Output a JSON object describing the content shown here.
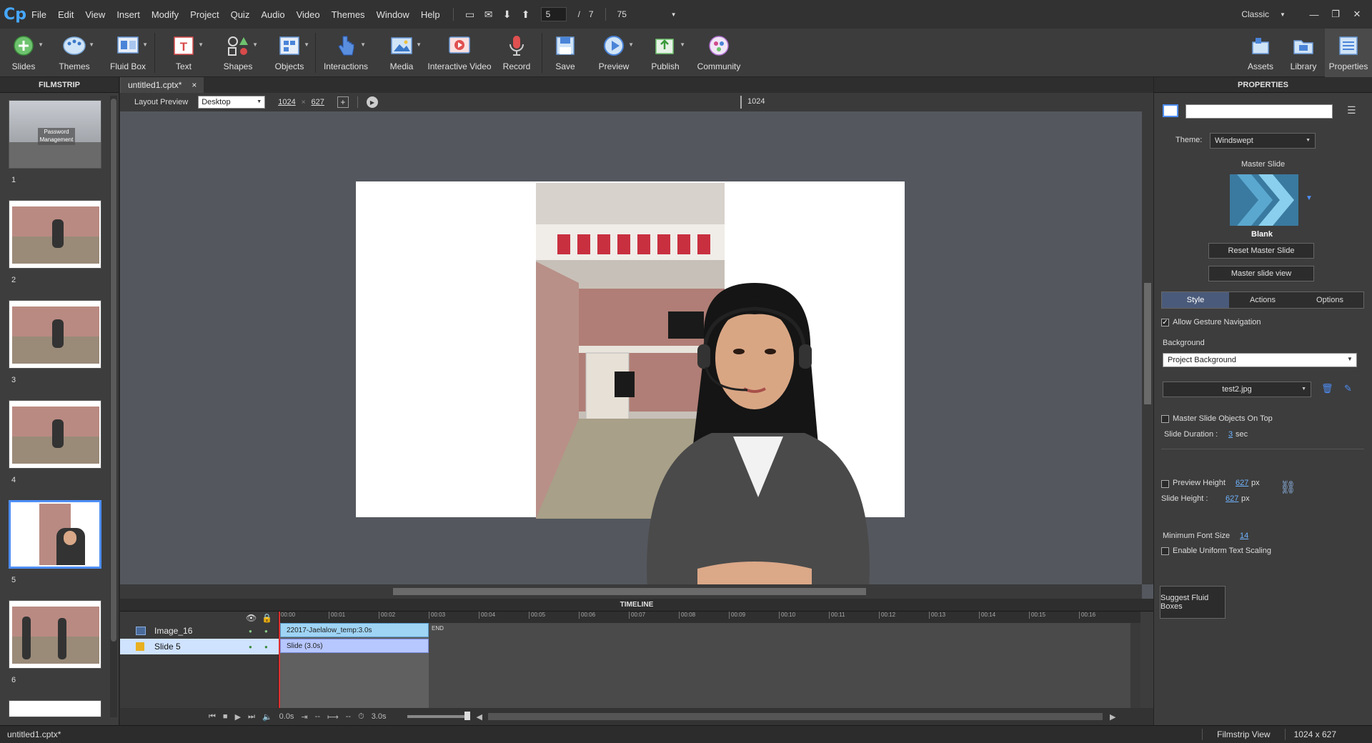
{
  "app": {
    "logo": "Cp"
  },
  "menu": [
    "File",
    "Edit",
    "View",
    "Insert",
    "Modify",
    "Project",
    "Quiz",
    "Audio",
    "Video",
    "Themes",
    "Window",
    "Help"
  ],
  "nav": {
    "current_slide": "5",
    "separator": "/",
    "total_slides": "7",
    "zoom": "75"
  },
  "workspace": {
    "label": "Classic"
  },
  "toolbar": {
    "slides": "Slides",
    "themes": "Themes",
    "fluid_box": "Fluid Box",
    "text": "Text",
    "shapes": "Shapes",
    "objects": "Objects",
    "interactions": "Interactions",
    "media": "Media",
    "interactive_video": "Interactive Video",
    "record": "Record",
    "save": "Save",
    "preview": "Preview",
    "publish": "Publish",
    "community": "Community",
    "assets": "Assets",
    "library": "Library",
    "properties": "Properties"
  },
  "filmstrip": {
    "title": "FILMSTRIP",
    "slides": [
      {
        "num": "1",
        "caption": "Password Management"
      },
      {
        "num": "2"
      },
      {
        "num": "3"
      },
      {
        "num": "4"
      },
      {
        "num": "5"
      },
      {
        "num": "6"
      }
    ]
  },
  "document": {
    "tab": "untitled1.cptx*",
    "close": "×"
  },
  "layout_preview": {
    "label": "Layout Preview",
    "device": "Desktop",
    "width": "1024",
    "x": "×",
    "height": "627",
    "marker": "1024"
  },
  "timeline": {
    "title": "TIMELINE",
    "rows": [
      {
        "name": "Image_16",
        "bar": "22017-Jaelalow_temp:3.0s"
      },
      {
        "name": "Slide 5",
        "bar": "Slide (3.0s)"
      }
    ],
    "end_label": "END",
    "ticks": [
      "00:00",
      "00:01",
      "00:02",
      "00:03",
      "00:04",
      "00:05",
      "00:06",
      "00:07",
      "00:08",
      "00:09",
      "00:10",
      "00:11",
      "00:12",
      "00:13",
      "00:14",
      "00:15",
      "00:16"
    ],
    "controls": {
      "time1": "0.0s",
      "dash1": "--",
      "dash2": "--",
      "duration": "3.0s"
    }
  },
  "properties": {
    "title": "PROPERTIES",
    "theme_label": "Theme:",
    "theme_value": "Windswept",
    "master_slide_label": "Master Slide",
    "master_slide_name": "Blank",
    "reset_master": "Reset Master Slide",
    "master_view": "Master slide view",
    "tabs": [
      "Style",
      "Actions",
      "Options"
    ],
    "allow_gesture": "Allow Gesture Navigation",
    "background_label": "Background",
    "background_value": "Project Background",
    "image_file": "test2.jpg",
    "master_on_top": "Master Slide Objects On Top",
    "slide_duration_label": "Slide Duration :",
    "slide_duration_value": "3",
    "slide_duration_unit": "sec",
    "preview_height_label": "Preview Height",
    "preview_height_value": "627",
    "px": "px",
    "slide_height_label": "Slide Height :",
    "slide_height_value": "627",
    "min_font_label": "Minimum Font Size",
    "min_font_value": "14",
    "uniform_scaling": "Enable Uniform Text Scaling",
    "suggest_fluid": "Suggest Fluid Boxes"
  },
  "status": {
    "file": "untitled1.cptx*",
    "view": "Filmstrip View",
    "size": "1024 x 627"
  },
  "colors": {
    "accent": "#4e8ef7",
    "panel": "#3d3d3d",
    "stage": "#54575e"
  }
}
